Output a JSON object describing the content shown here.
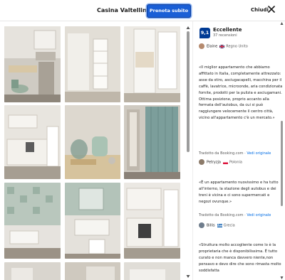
{
  "header": {
    "title": "Casina Valtellina 10",
    "book_label": "Prenota subito",
    "close_label": "Chiudi"
  },
  "reviews_panel": {
    "score": "9,1",
    "grade": "Eccellente",
    "count": "37 recensioni",
    "top_reviewer": {
      "name": "Elaine",
      "country": "Regno Unito"
    },
    "reviews": [
      {
        "text": "«Il miglior appartamento che abbiamo affittato in Italia, completamente attrezzato: asse da stiro, asciugacapelli, macchina per il caffè, lavatrice, microonde, aria condizionata fornite, prodotti per la pulizia e asciugamani. Ottima posizione, proprio accanto alla fermata dell'autobus, da cui si può raggiungere velocemente il centro città, vicino all'appartamento c'è un mercato.»",
        "translated_prefix": "Tradotto da ",
        "translated_by": "Booking.com",
        "view_original": "Vedi originale",
        "reviewer": "Petryzja",
        "country": "Polonia"
      },
      {
        "text": "«È un appartamento nuovissimo e ha tutto all'interno, la stazione degli autobus e dei treni è vicina e ci sono supermercati e negozi ovunque.»",
        "translated_prefix": "Tradotto da ",
        "translated_by": "Booking.com",
        "view_original": "Vedi originale",
        "reviewer": "Billis",
        "country": "Grecia"
      },
      {
        "text": "«Struttura molto accogliente come lo è la proprietaria che è disponibilissima. È tutto curato e non manca davvero niente,non pensavo e devo dire che sono rimasta molto soddisfatta",
        "reviewer": "",
        "country": ""
      }
    ]
  },
  "icons": {
    "close": "close-icon",
    "score": "score-badge",
    "flag": "flag-icon"
  },
  "colors": {
    "brand_blue": "#003b95",
    "cta_blue": "#1a5fd6",
    "link_blue": "#006ce4"
  }
}
